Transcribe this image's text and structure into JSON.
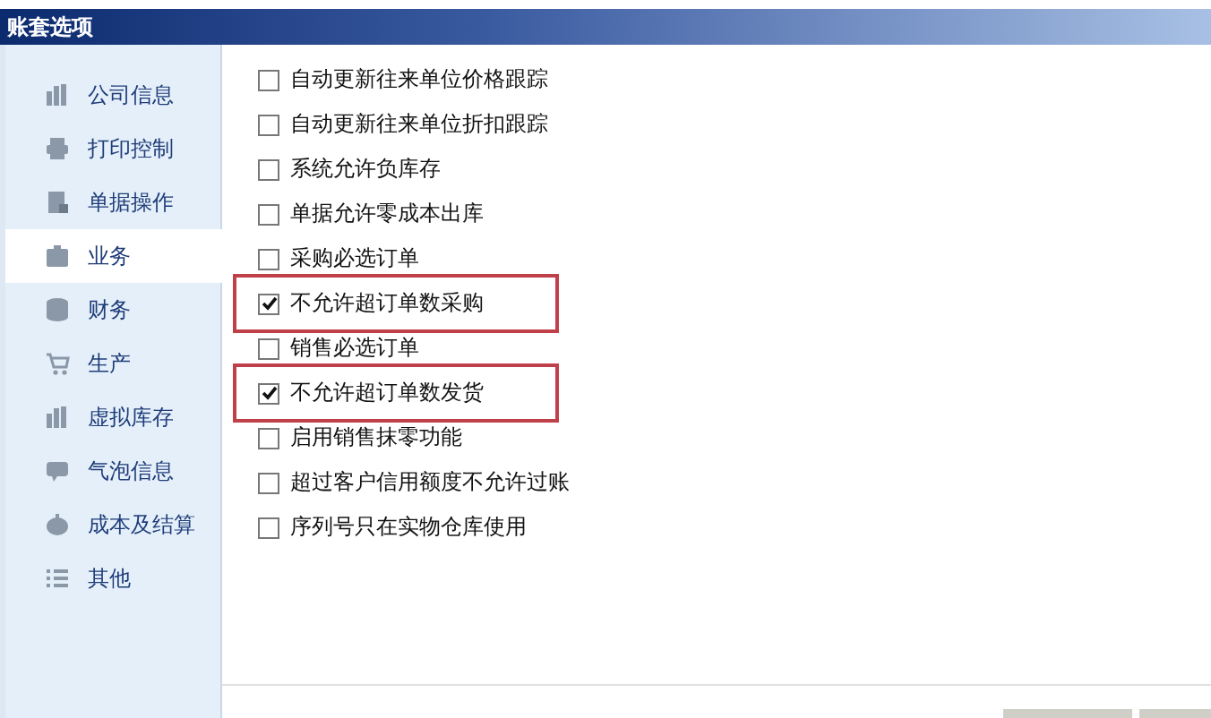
{
  "window": {
    "title": "账套选项"
  },
  "sidebar": {
    "items": [
      {
        "label": "公司信息",
        "selected": false
      },
      {
        "label": "打印控制",
        "selected": false
      },
      {
        "label": "单据操作",
        "selected": false
      },
      {
        "label": "业务",
        "selected": true
      },
      {
        "label": "财务",
        "selected": false
      },
      {
        "label": "生产",
        "selected": false
      },
      {
        "label": "虚拟库存",
        "selected": false
      },
      {
        "label": "气泡信息",
        "selected": false
      },
      {
        "label": "成本及结算",
        "selected": false
      },
      {
        "label": "其他",
        "selected": false
      }
    ]
  },
  "options": [
    {
      "label": "自动更新往来单位价格跟踪",
      "checked": false,
      "highlighted": false
    },
    {
      "label": "自动更新往来单位折扣跟踪",
      "checked": false,
      "highlighted": false
    },
    {
      "label": "系统允许负库存",
      "checked": false,
      "highlighted": false
    },
    {
      "label": "单据允许零成本出库",
      "checked": false,
      "highlighted": false
    },
    {
      "label": "采购必选订单",
      "checked": false,
      "highlighted": false
    },
    {
      "label": "不允许超订单数采购",
      "checked": true,
      "highlighted": true
    },
    {
      "label": "销售必选订单",
      "checked": false,
      "highlighted": false
    },
    {
      "label": "不允许超订单数发货",
      "checked": true,
      "highlighted": true
    },
    {
      "label": "启用销售抹零功能",
      "checked": false,
      "highlighted": false
    },
    {
      "label": "超过客户信用额度不允许过账",
      "checked": false,
      "highlighted": false
    },
    {
      "label": "序列号只在实物仓库使用",
      "checked": false,
      "highlighted": false
    }
  ]
}
